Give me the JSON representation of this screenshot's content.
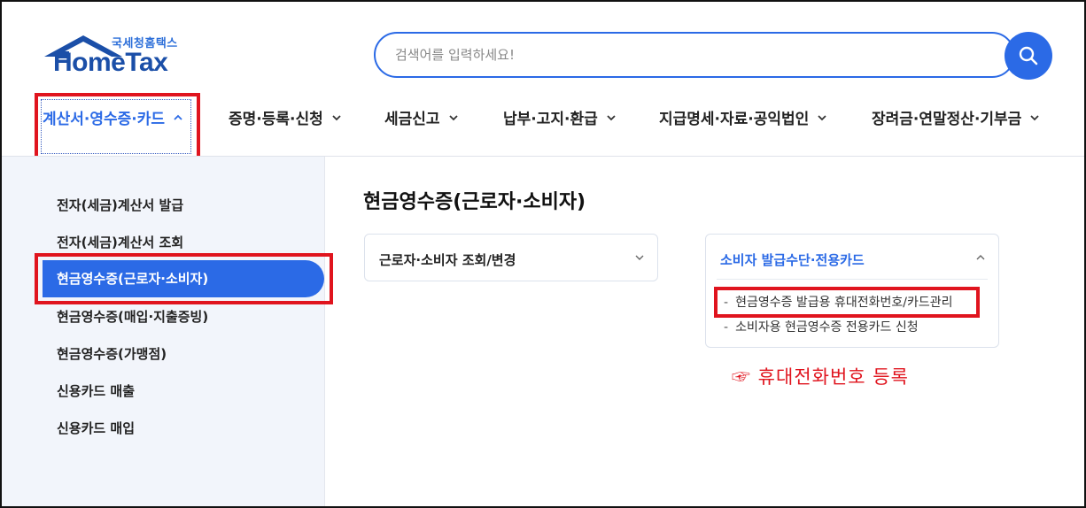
{
  "logo": {
    "subtitle": "국세청홈택스",
    "name": "HomeTax"
  },
  "search": {
    "placeholder": "검색어를 입력하세요!"
  },
  "nav": {
    "items": [
      {
        "label": "계산서·영수증·카드",
        "active": true
      },
      {
        "label": "증명·등록·신청"
      },
      {
        "label": "세금신고"
      },
      {
        "label": "납부·고지·환급"
      },
      {
        "label": "지급명세·자료·공익법인"
      },
      {
        "label": "장려금·연말정산·기부금"
      }
    ]
  },
  "sidebar": {
    "items": [
      {
        "label": "전자(세금)계산서 발급"
      },
      {
        "label": "전자(세금)계산서 조회"
      },
      {
        "label": "현금영수증(근로자·소비자)",
        "active": true
      },
      {
        "label": "현금영수증(매입·지출증빙)"
      },
      {
        "label": "현금영수증(가맹점)"
      },
      {
        "label": "신용카드 매출"
      },
      {
        "label": "신용카드 매입"
      }
    ]
  },
  "main": {
    "title": "현금영수증(근로자·소비자)",
    "card_left": {
      "heading": "근로자·소비자 조회/변경"
    },
    "card_right": {
      "heading": "소비자 발급수단·전용카드",
      "items": [
        {
          "label": "현금영수증 발급용 휴대전화번호/카드관리"
        },
        {
          "label": "소비자용 현금영수증 전용카드 신청"
        }
      ]
    },
    "annotation": "☞ 휴대전화번호 등록"
  },
  "colors": {
    "accent": "#2b6ae6",
    "highlight": "#e0141e",
    "sidebar_bg": "#f2f5fb"
  }
}
